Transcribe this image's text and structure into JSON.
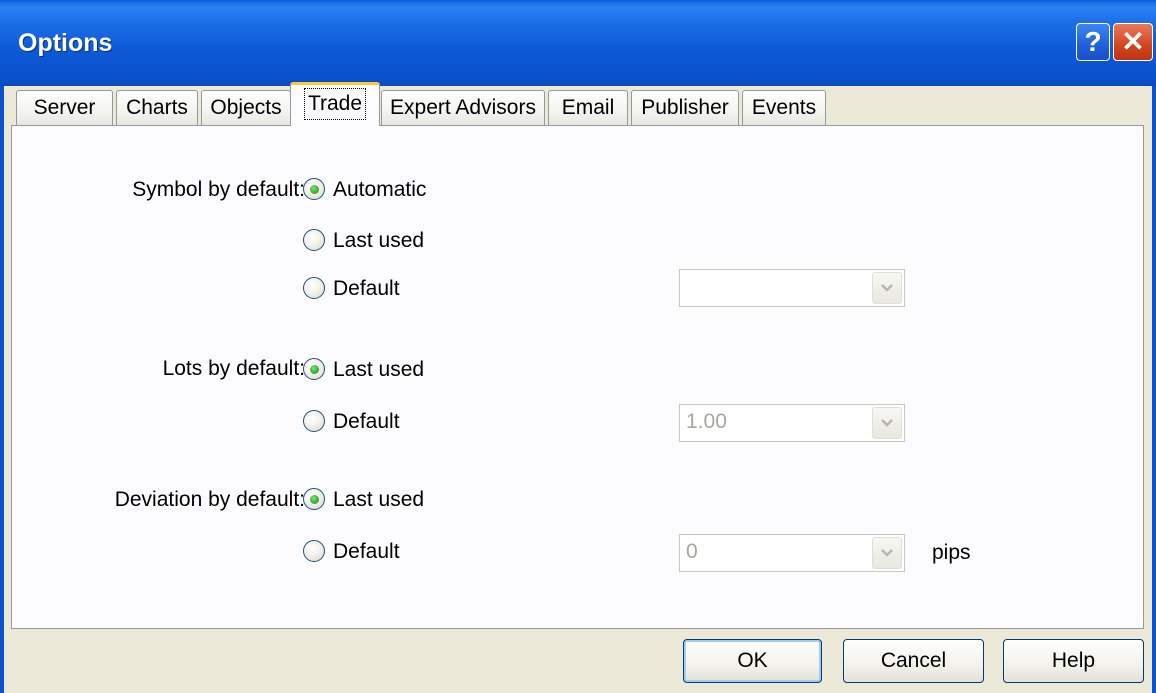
{
  "window": {
    "title": "Options",
    "help_glyph": "?",
    "close_glyph": "✕"
  },
  "tabs": [
    {
      "label": "Server",
      "active": false
    },
    {
      "label": "Charts",
      "active": false
    },
    {
      "label": "Objects",
      "active": false
    },
    {
      "label": "Trade",
      "active": true
    },
    {
      "label": "Expert Advisors",
      "active": false
    },
    {
      "label": "Email",
      "active": false
    },
    {
      "label": "Publisher",
      "active": false
    },
    {
      "label": "Events",
      "active": false
    }
  ],
  "symbol": {
    "label": "Symbol by default:",
    "options": [
      {
        "label": "Automatic",
        "checked": true
      },
      {
        "label": "Last used",
        "checked": false
      },
      {
        "label": "Default",
        "checked": false
      }
    ],
    "combo_value": ""
  },
  "lots": {
    "label": "Lots by default:",
    "options": [
      {
        "label": "Last used",
        "checked": true
      },
      {
        "label": "Default",
        "checked": false
      }
    ],
    "combo_value": "1.00"
  },
  "deviation": {
    "label": "Deviation by default:",
    "options": [
      {
        "label": "Last used",
        "checked": true
      },
      {
        "label": "Default",
        "checked": false
      }
    ],
    "combo_value": "0",
    "unit": "pips"
  },
  "buttons": {
    "ok": "OK",
    "cancel": "Cancel",
    "help": "Help"
  },
  "colors": {
    "titlebar": "#0a52cc",
    "dialog_bg": "#ece9d8",
    "panel_bg": "#fcfcfe",
    "active_tab_accent": "#ffc83c",
    "radio_dot": "#3fb13a"
  },
  "icons": {
    "help": "question-mark-icon",
    "close": "close-icon",
    "dropdown": "chevron-down-icon"
  }
}
